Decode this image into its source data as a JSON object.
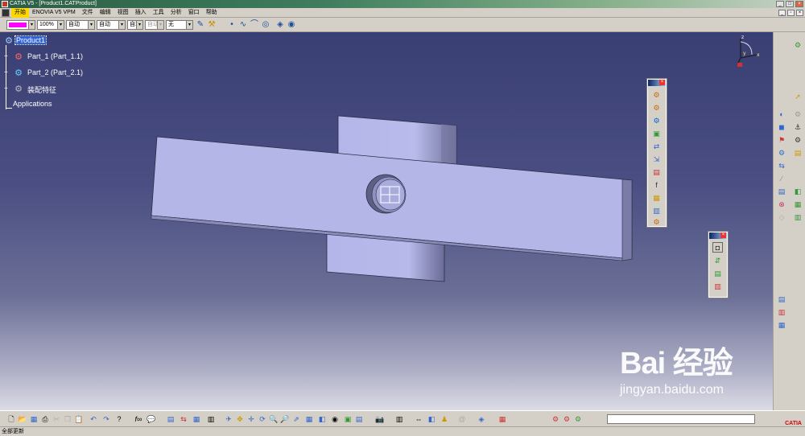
{
  "window": {
    "title": "CATIA V5 - [Product1.CATProduct]",
    "minimize": "_",
    "maximize": "□",
    "close": "×"
  },
  "menu": {
    "items": [
      "开始",
      "ENOVIA V5 VPM",
      "文件",
      "编辑",
      "视图",
      "插入",
      "工具",
      "分析",
      "窗口",
      "帮助"
    ]
  },
  "toolbar_top": {
    "color": "#ff00ff",
    "transparency": "100%",
    "linetype": "自动",
    "lineweight": "自动",
    "layer": "自动",
    "render_style": "自动",
    "layer_name": "无"
  },
  "tree": {
    "root": "Product1",
    "children": [
      {
        "label": "Part_1 (Part_1.1)"
      },
      {
        "label": "Part_2 (Part_2.1)"
      },
      {
        "label": "装配特征"
      }
    ],
    "applications": "Applications"
  },
  "compass": {
    "z": "z",
    "x": "x",
    "y": "y"
  },
  "watermark": {
    "brand": "Bai 经验",
    "url": "jingyan.baidu.com"
  },
  "status": {
    "text": "全部更新"
  },
  "logo": {
    "text": "CATIA"
  }
}
